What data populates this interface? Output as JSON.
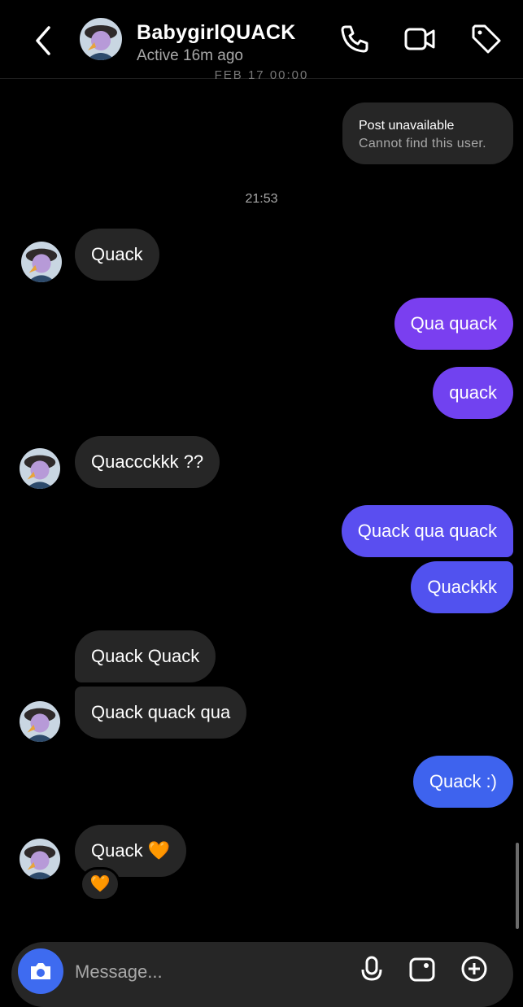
{
  "header": {
    "name": "BabygirlQUACK",
    "status": "Active 16m ago"
  },
  "conversation": {
    "cut_timestamp": "FEB 17 00:00",
    "shared_post": {
      "title": "Post unavailable",
      "subtitle": "Cannot find this user."
    },
    "time_separator": "21:53",
    "messages": [
      {
        "sender": "them",
        "text": "Quack"
      },
      {
        "sender": "me",
        "text": "Qua quack"
      },
      {
        "sender": "me",
        "text": "quack"
      },
      {
        "sender": "them",
        "text": "Quaccckkk ??"
      },
      {
        "sender": "me",
        "text": "Quack qua quack"
      },
      {
        "sender": "me",
        "text": "Quackkk"
      },
      {
        "sender": "them",
        "text": "Quack Quack"
      },
      {
        "sender": "them",
        "text": "Quack quack qua"
      },
      {
        "sender": "me",
        "text": "Quack :)"
      },
      {
        "sender": "them",
        "text": "Quack 🧡"
      }
    ],
    "reaction": "🧡"
  },
  "composer": {
    "placeholder": "Message..."
  },
  "colors": {
    "incoming_bubble": "#262626",
    "outgoing_top": "#7a3ff0",
    "outgoing_mid": "#5a4ef0",
    "outgoing_bottom": "#3e63ee",
    "camera_button": "#3e6bf0"
  },
  "icons": [
    "back-chevron-icon",
    "phone-icon",
    "video-camera-icon",
    "tag-icon",
    "camera-icon",
    "microphone-icon",
    "gallery-icon",
    "plus-circle-icon"
  ]
}
